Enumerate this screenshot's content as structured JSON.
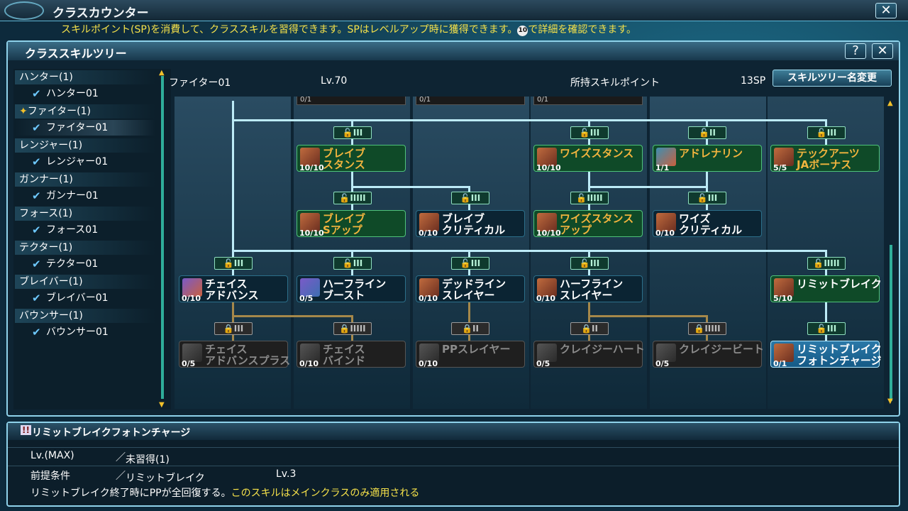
{
  "window": {
    "title": "クラスカウンター",
    "instruction_pre": "スキルポイント(SP)を消費して、クラススキルを習得できます。SPはレベルアップ時に獲得できます。",
    "instruction_key": "10",
    "instruction_post": "で詳細を確認できます。"
  },
  "panel": {
    "title": "クラススキルツリー",
    "help": "?",
    "close": "✕"
  },
  "sidebar": [
    {
      "class": "ハンター(1)",
      "tree": "ハンター01"
    },
    {
      "class": "ファイター(1)",
      "tree": "ファイター01",
      "selected": true
    },
    {
      "class": "レンジャー(1)",
      "tree": "レンジャー01"
    },
    {
      "class": "ガンナー(1)",
      "tree": "ガンナー01"
    },
    {
      "class": "フォース(1)",
      "tree": "フォース01"
    },
    {
      "class": "テクター(1)",
      "tree": "テクター01"
    },
    {
      "class": "ブレイバー(1)",
      "tree": "ブレイバー01"
    },
    {
      "class": "バウンサー(1)",
      "tree": "バウンサー01"
    }
  ],
  "header": {
    "tree_name": "ファイター01",
    "level": "Lv.70",
    "sp_label": "所持スキルポイント",
    "sp_value": "13SP",
    "rename_button": "スキルツリー名変更"
  },
  "partials": [
    "0/1",
    "0/1",
    "0/1"
  ],
  "locks": {
    "r1": [
      "III",
      "III",
      "II",
      "III"
    ],
    "r2": [
      "IIIII",
      "III",
      "IIIII",
      "III"
    ],
    "r3": [
      "III",
      "III",
      "III",
      "III",
      "IIIII"
    ],
    "r4": [
      "III",
      "IIIII",
      "II",
      "II",
      "IIIII",
      "III"
    ]
  },
  "nodes": {
    "brave_stance": {
      "name1": "ブレイブ",
      "name2": "スタンス",
      "lv": "10/10"
    },
    "wise_stance": {
      "name1": "ワイズスタンス",
      "name2": "",
      "lv": "10/10"
    },
    "adrenaline": {
      "name1": "アドレナリン",
      "name2": "",
      "lv": "1/1"
    },
    "tech_arts": {
      "name1": "テックアーツ",
      "name2": "JAボーナス",
      "lv": "5/5"
    },
    "brave_s_up": {
      "name1": "ブレイブ",
      "name2": "Sアップ",
      "lv": "10/10"
    },
    "brave_crit": {
      "name1": "ブレイブ",
      "name2": "クリティカル",
      "lv": "0/10"
    },
    "wise_s_up": {
      "name1": "ワイズスタンス",
      "name2": "アップ",
      "lv": "10/10"
    },
    "wise_crit": {
      "name1": "ワイズ",
      "name2": "クリティカル",
      "lv": "0/10"
    },
    "chase_adv": {
      "name1": "チェイス",
      "name2": "アドバンス",
      "lv": "0/10"
    },
    "halfline_boost": {
      "name1": "ハーフライン",
      "name2": "ブースト",
      "lv": "0/5"
    },
    "deadline_slayer": {
      "name1": "デッドライン",
      "name2": "スレイヤー",
      "lv": "0/10"
    },
    "halfline_slayer": {
      "name1": "ハーフライン",
      "name2": "スレイヤー",
      "lv": "0/10"
    },
    "limit_break": {
      "name1": "リミットブレイク",
      "name2": "",
      "lv": "5/10"
    },
    "chase_adv_plus": {
      "name1": "チェイス",
      "name2": "アドバンスプラス",
      "lv": "0/5"
    },
    "chase_bind": {
      "name1": "チェイス",
      "name2": "バインド",
      "lv": "0/10"
    },
    "pp_slayer": {
      "name1": "PPスレイヤー",
      "name2": "",
      "lv": "0/10"
    },
    "crazy_heart": {
      "name1": "クレイジーハート",
      "name2": "",
      "lv": "0/5"
    },
    "crazy_beat": {
      "name1": "クレイジービート",
      "name2": "",
      "lv": "0/5"
    },
    "limit_break_pc": {
      "name1": "リミットブレイク",
      "name2": "フォトンチャージ",
      "lv": "0/1"
    }
  },
  "detail": {
    "warn_icon": "!!",
    "skill_name": "リミットブレイクフォトンチャージ",
    "lv_label": "Lv.(MAX)",
    "lv_value": "未習得(1)",
    "req_label": "前提条件",
    "req_value": "リミットブレイク",
    "req_lv": "Lv.3",
    "desc_main": "リミットブレイク終了時にPPが全回復する。",
    "desc_note": "このスキルはメインクラスのみ適用される"
  },
  "colors": {
    "accent": "#8fd2ea",
    "learned": "#0f4a28",
    "highlight": "#f6e24a"
  }
}
